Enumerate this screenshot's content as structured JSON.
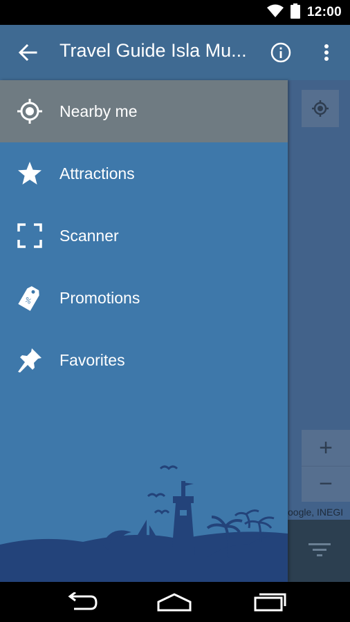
{
  "status_bar": {
    "time": "12:00",
    "icons": [
      "wifi-icon",
      "battery-icon"
    ]
  },
  "app_bar": {
    "title": "Travel Guide Isla Mu...",
    "back_icon": "arrow-back-icon",
    "info_icon": "info-icon",
    "more_icon": "more-vert-icon"
  },
  "drawer": {
    "items": [
      {
        "label": "Nearby me",
        "icon": "gps-target-icon",
        "active": true
      },
      {
        "label": "Attractions",
        "icon": "star-icon",
        "active": false
      },
      {
        "label": "Scanner",
        "icon": "scan-frame-icon",
        "active": false
      },
      {
        "label": "Promotions",
        "icon": "discount-tag-icon",
        "active": false
      },
      {
        "label": "Favorites",
        "icon": "pin-icon",
        "active": false
      }
    ]
  },
  "map": {
    "attribution": "oogle, INEGI",
    "zoom_in": "+",
    "zoom_out": "−"
  },
  "colors": {
    "app_bar": "#3f6a92",
    "drawer": "#3e78aa",
    "active_item": "#6f7b82",
    "illustration": "#23437a"
  }
}
